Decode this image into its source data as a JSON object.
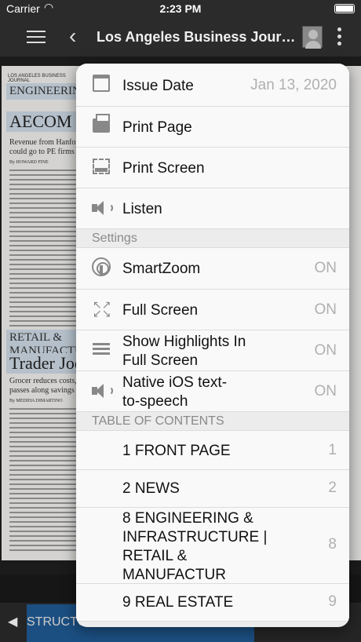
{
  "status_bar": {
    "carrier": "Carrier",
    "time": "2:23 PM"
  },
  "nav": {
    "title": "Los Angeles Business Journal"
  },
  "newspaper": {
    "publication": "LOS ANGELES BUSINESS JOURNAL",
    "section1": "ENGINEERING",
    "headline1": "AECOM",
    "dek1": "Revenue from Hanford could go to PE firms",
    "byline1": "By HOWARD FINE",
    "section2": "RETAIL & MANUFACTURING",
    "headline2": "Trader Joe's",
    "dek2": "Grocer reduces costs, passes along savings",
    "byline2": "By MEDIHA DIMARTINO"
  },
  "bottom_bar": {
    "tab_label": "STRUCTURE"
  },
  "menu": {
    "issue_date_label": "Issue Date",
    "issue_date_value": "Jan 13, 2020",
    "print_page_label": "Print Page",
    "print_screen_label": "Print Screen",
    "listen_label": "Listen",
    "settings_header": "Settings",
    "smartzoom_label": "SmartZoom",
    "smartzoom_value": "ON",
    "fullscreen_label": "Full Screen",
    "fullscreen_value": "ON",
    "highlights_label_line1": "Show Highlights In",
    "highlights_label_line2": "Full Screen",
    "highlights_value": "ON",
    "native_tts_label_line1": "Native iOS text-",
    "native_tts_label_line2": "to-speech",
    "native_tts_value": "ON",
    "toc_header": "TABLE OF CONTENTS",
    "toc": [
      {
        "title": "1 FRONT PAGE",
        "page": "1"
      },
      {
        "title": "2 NEWS",
        "page": "2"
      },
      {
        "title_line1": "8 ENGINEERING &",
        "title_line2": "INFRASTRUCTURE |",
        "title_line3": "RETAIL &",
        "title_line4": "MANUFACTUR",
        "page": "8"
      },
      {
        "title": "9 REAL ESTATE",
        "page": "9"
      }
    ]
  },
  "icons": {
    "menu": "hamburger-icon",
    "back": "chevron-left-icon",
    "avatar": "user-avatar-icon",
    "more": "more-vertical-icon",
    "calendar": "calendar-icon",
    "printer": "printer-icon",
    "screen": "print-screen-icon",
    "speaker": "speaker-icon",
    "smartzoom": "smartzoom-icon",
    "fullscreen": "expand-icon",
    "highlights": "highlights-icon",
    "prev": "triangle-left-icon"
  },
  "colors": {
    "bar_bg": "#2b2b2b",
    "popup_bg": "#f9f9f9",
    "section_header_bg": "#ececec",
    "accent_tab": "#1f5a94",
    "value_gray": "#b0b0b0"
  }
}
